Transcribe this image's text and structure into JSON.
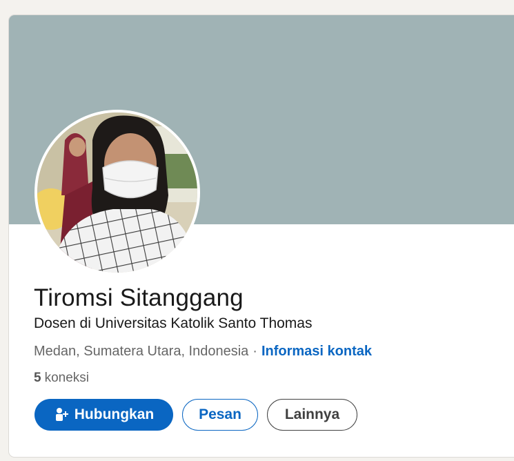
{
  "profile": {
    "name": "Tiromsi Sitanggang",
    "headline": "Dosen di Universitas Katolik Santo Thomas",
    "location": "Medan, Sumatera Utara, Indonesia",
    "separator": "·",
    "contact_link": "Informasi kontak",
    "connections_count": "5",
    "connections_label": "koneksi"
  },
  "actions": {
    "connect_label": "Hubungkan",
    "message_label": "Pesan",
    "more_label": "Lainnya"
  },
  "colors": {
    "cover": "#a0b3b5",
    "primary": "#0a66c2",
    "text": "#191919",
    "muted": "#666666"
  },
  "icons": {
    "connect": "person-add-icon"
  }
}
